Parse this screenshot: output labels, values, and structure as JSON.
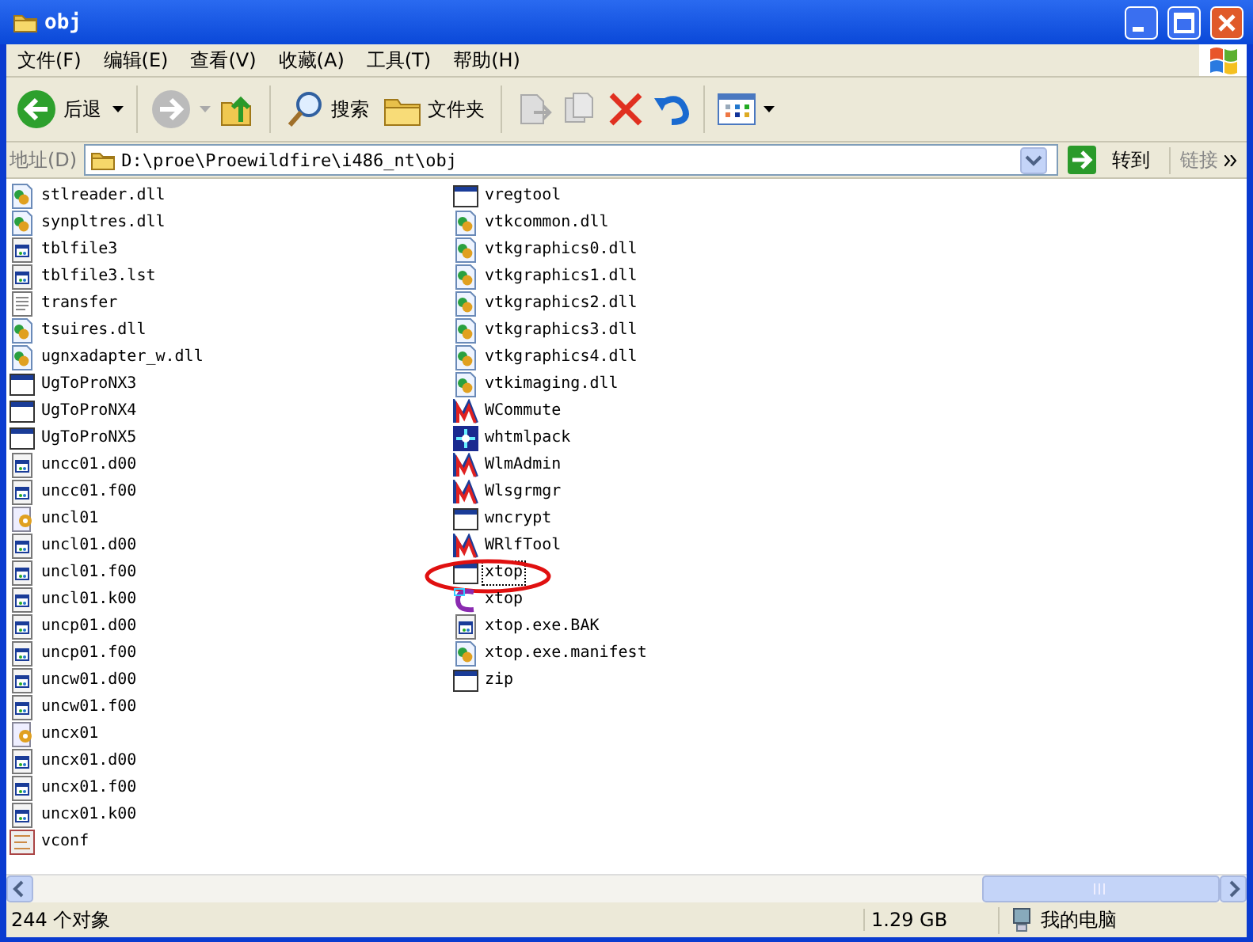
{
  "window": {
    "title": "obj"
  },
  "menu": [
    "文件(F)",
    "编辑(E)",
    "查看(V)",
    "收藏(A)",
    "工具(T)",
    "帮助(H)"
  ],
  "toolbar": {
    "back": "后退",
    "search": "搜索",
    "folders": "文件夹"
  },
  "address": {
    "label": "地址(D)",
    "value": "D:\\proe\\Proewildfire\\i486_nt\\obj",
    "go": "转到",
    "links": "链接"
  },
  "columns": [
    [
      {
        "name": "stlreader.dll",
        "kind": "dll"
      },
      {
        "name": "synpltres.dll",
        "kind": "dll"
      },
      {
        "name": "tblfile3",
        "kind": "doc"
      },
      {
        "name": "tblfile3.lst",
        "kind": "doc"
      },
      {
        "name": "transfer",
        "kind": "text"
      },
      {
        "name": "tsuires.dll",
        "kind": "dll"
      },
      {
        "name": "ugnxadapter_w.dll",
        "kind": "dll"
      },
      {
        "name": "UgToProNX3",
        "kind": "app"
      },
      {
        "name": "UgToProNX4",
        "kind": "app"
      },
      {
        "name": "UgToProNX5",
        "kind": "app"
      },
      {
        "name": "uncc01.d00",
        "kind": "doc"
      },
      {
        "name": "uncc01.f00",
        "kind": "doc"
      },
      {
        "name": "uncl01",
        "kind": "script"
      },
      {
        "name": "uncl01.d00",
        "kind": "doc"
      },
      {
        "name": "uncl01.f00",
        "kind": "doc"
      },
      {
        "name": "uncl01.k00",
        "kind": "doc"
      },
      {
        "name": "uncp01.d00",
        "kind": "doc"
      },
      {
        "name": "uncp01.f00",
        "kind": "doc"
      },
      {
        "name": "uncw01.d00",
        "kind": "doc"
      },
      {
        "name": "uncw01.f00",
        "kind": "doc"
      },
      {
        "name": "uncx01",
        "kind": "script"
      },
      {
        "name": "uncx01.d00",
        "kind": "doc"
      },
      {
        "name": "uncx01.f00",
        "kind": "doc"
      },
      {
        "name": "uncx01.k00",
        "kind": "doc"
      },
      {
        "name": "vconf",
        "kind": "config"
      }
    ],
    [
      {
        "name": "vregtool",
        "kind": "app"
      },
      {
        "name": "vtkcommon.dll",
        "kind": "dll"
      },
      {
        "name": "vtkgraphics0.dll",
        "kind": "dll"
      },
      {
        "name": "vtkgraphics1.dll",
        "kind": "dll"
      },
      {
        "name": "vtkgraphics2.dll",
        "kind": "dll"
      },
      {
        "name": "vtkgraphics3.dll",
        "kind": "dll"
      },
      {
        "name": "vtkgraphics4.dll",
        "kind": "dll"
      },
      {
        "name": "vtkimaging.dll",
        "kind": "dll"
      },
      {
        "name": "WCommute",
        "kind": "license"
      },
      {
        "name": "whtmlpack",
        "kind": "network"
      },
      {
        "name": "WlmAdmin",
        "kind": "license"
      },
      {
        "name": "Wlsgrmgr",
        "kind": "license"
      },
      {
        "name": "wncrypt",
        "kind": "app"
      },
      {
        "name": "WRlfTool",
        "kind": "license"
      },
      {
        "name": "xtop",
        "kind": "app",
        "focused": true,
        "circled": true
      },
      {
        "name": "xtop",
        "kind": "xtop"
      },
      {
        "name": "xtop.exe.BAK",
        "kind": "doc"
      },
      {
        "name": "xtop.exe.manifest",
        "kind": "dll"
      },
      {
        "name": "zip",
        "kind": "app"
      }
    ]
  ],
  "status_bar": {
    "count": "244 个对象",
    "size": "1.29 GB",
    "location": "我的电脑"
  }
}
